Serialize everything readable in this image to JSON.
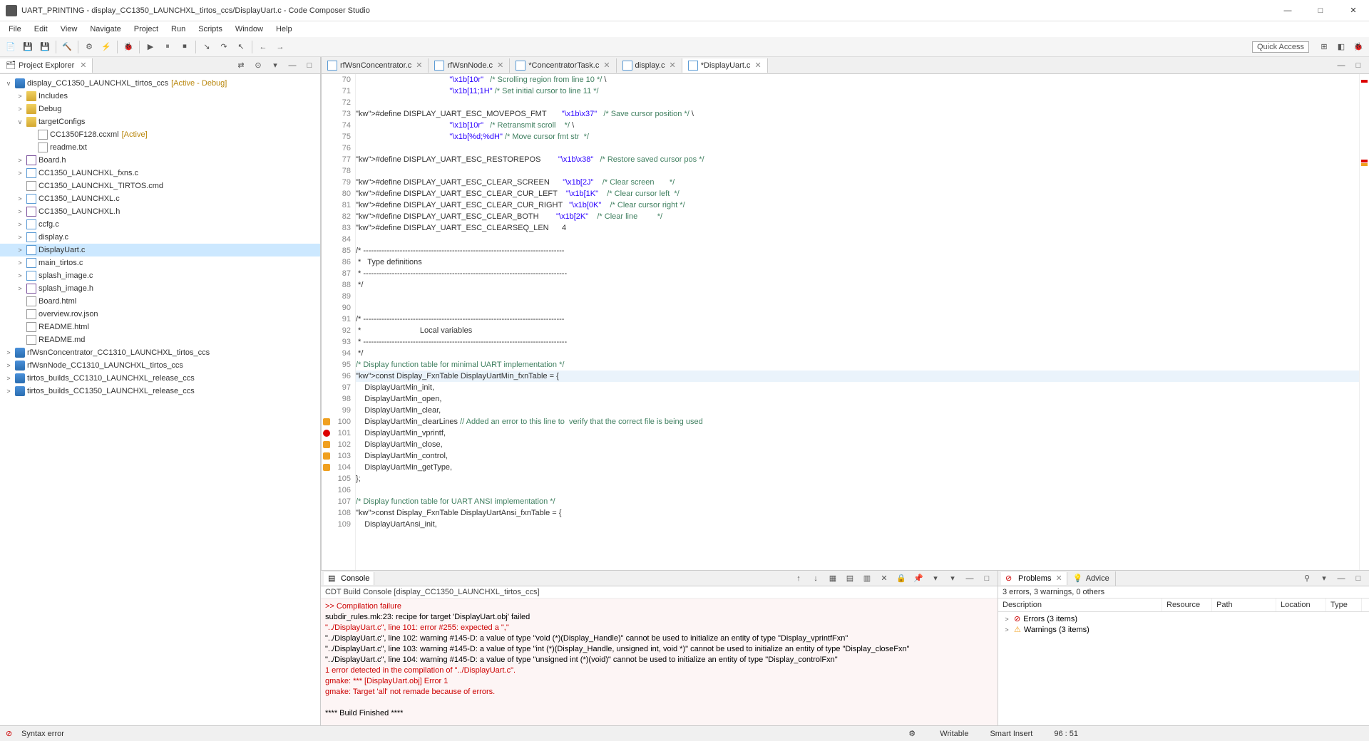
{
  "window": {
    "title": "UART_PRINTING - display_CC1350_LAUNCHXL_tirtos_ccs/DisplayUart.c - Code Composer Studio"
  },
  "menu": [
    "File",
    "Edit",
    "View",
    "Navigate",
    "Project",
    "Run",
    "Scripts",
    "Window",
    "Help"
  ],
  "quick_access": "Quick Access",
  "project_explorer": {
    "title": "Project Explorer",
    "root": {
      "label": "display_CC1350_LAUNCHXL_tirtos_ccs",
      "anno": "[Active - Debug]"
    },
    "children": [
      {
        "label": "Includes",
        "type": "folder",
        "exp": ">"
      },
      {
        "label": "Debug",
        "type": "folder",
        "exp": ">"
      },
      {
        "label": "targetConfigs",
        "type": "folder",
        "exp": "v",
        "children": [
          {
            "label": "CC1350F128.ccxml",
            "anno": "[Active]",
            "type": "file"
          },
          {
            "label": "readme.txt",
            "type": "file"
          }
        ]
      },
      {
        "label": "Board.h",
        "type": "h",
        "exp": ">"
      },
      {
        "label": "CC1350_LAUNCHXL_fxns.c",
        "type": "c",
        "exp": ">"
      },
      {
        "label": "CC1350_LAUNCHXL_TIRTOS.cmd",
        "type": "file"
      },
      {
        "label": "CC1350_LAUNCHXL.c",
        "type": "c",
        "exp": ">"
      },
      {
        "label": "CC1350_LAUNCHXL.h",
        "type": "h",
        "exp": ">"
      },
      {
        "label": "ccfg.c",
        "type": "c",
        "exp": ">"
      },
      {
        "label": "display.c",
        "type": "c",
        "exp": ">"
      },
      {
        "label": "DisplayUart.c",
        "type": "c",
        "exp": ">",
        "selected": true
      },
      {
        "label": "main_tirtos.c",
        "type": "c",
        "exp": ">"
      },
      {
        "label": "splash_image.c",
        "type": "c",
        "exp": ">"
      },
      {
        "label": "splash_image.h",
        "type": "h",
        "exp": ">"
      },
      {
        "label": "Board.html",
        "type": "file"
      },
      {
        "label": "overview.rov.json",
        "type": "file"
      },
      {
        "label": "README.html",
        "type": "file"
      },
      {
        "label": "README.md",
        "type": "file"
      }
    ],
    "siblings": [
      "rfWsnConcentrator_CC1310_LAUNCHXL_tirtos_ccs",
      "rfWsnNode_CC1310_LAUNCHXL_tirtos_ccs",
      "tirtos_builds_CC1310_LAUNCHXL_release_ccs",
      "tirtos_builds_CC1350_LAUNCHXL_release_ccs"
    ]
  },
  "editor_tabs": [
    {
      "label": "rfWsnConcentrator.c"
    },
    {
      "label": "rfWsnNode.c"
    },
    {
      "label": "*ConcentratorTask.c"
    },
    {
      "label": "display.c"
    },
    {
      "label": "*DisplayUart.c",
      "active": true
    }
  ],
  "code": [
    {
      "n": 70,
      "t": "                                           \"\\x1b[10r\"   /* Scrolling region from line 10 */ \\"
    },
    {
      "n": 71,
      "t": "                                           \"\\x1b[11;1H\" /* Set initial cursor to line 11 */"
    },
    {
      "n": 72,
      "t": ""
    },
    {
      "n": 73,
      "t": "#define DISPLAY_UART_ESC_MOVEPOS_FMT       \"\\x1b\\x37\"   /* Save cursor position */ \\"
    },
    {
      "n": 74,
      "t": "                                           \"\\x1b[10r\"   /* Retransmit scroll    */ \\"
    },
    {
      "n": 75,
      "t": "                                           \"\\x1b[%d;%dH\" /* Move cursor fmt str  */"
    },
    {
      "n": 76,
      "t": ""
    },
    {
      "n": 77,
      "t": "#define DISPLAY_UART_ESC_RESTOREPOS        \"\\x1b\\x38\"   /* Restore saved cursor pos */"
    },
    {
      "n": 78,
      "t": ""
    },
    {
      "n": 79,
      "t": "#define DISPLAY_UART_ESC_CLEAR_SCREEN      \"\\x1b[2J\"    /* Clear screen       */"
    },
    {
      "n": 80,
      "t": "#define DISPLAY_UART_ESC_CLEAR_CUR_LEFT    \"\\x1b[1K\"    /* Clear cursor left  */"
    },
    {
      "n": 81,
      "t": "#define DISPLAY_UART_ESC_CLEAR_CUR_RIGHT   \"\\x1b[0K\"    /* Clear cursor right */"
    },
    {
      "n": 82,
      "t": "#define DISPLAY_UART_ESC_CLEAR_BOTH        \"\\x1b[2K\"    /* Clear line         */"
    },
    {
      "n": 83,
      "t": "#define DISPLAY_UART_ESC_CLEARSEQ_LEN      4"
    },
    {
      "n": 84,
      "t": ""
    },
    {
      "n": 85,
      "t": "/* -----------------------------------------------------------------------------"
    },
    {
      "n": 86,
      "t": " *   Type definitions"
    },
    {
      "n": 87,
      "t": " * ------------------------------------------------------------------------------"
    },
    {
      "n": 88,
      "t": " */"
    },
    {
      "n": 89,
      "t": ""
    },
    {
      "n": 90,
      "t": ""
    },
    {
      "n": 91,
      "t": "/* -----------------------------------------------------------------------------"
    },
    {
      "n": 92,
      "t": " *                           Local variables"
    },
    {
      "n": 93,
      "t": " * ------------------------------------------------------------------------------"
    },
    {
      "n": 94,
      "t": " */"
    },
    {
      "n": 95,
      "t": "/* Display function table for minimal UART implementation */"
    },
    {
      "n": 96,
      "t": "const Display_FxnTable DisplayUartMin_fxnTable = {",
      "hl": true
    },
    {
      "n": 97,
      "t": "    DisplayUartMin_init,"
    },
    {
      "n": 98,
      "t": "    DisplayUartMin_open,"
    },
    {
      "n": 99,
      "t": "    DisplayUartMin_clear,"
    },
    {
      "n": 100,
      "t": "    DisplayUartMin_clearLines // Added an error to this line to  verify that the correct file is being used",
      "mark": "warn"
    },
    {
      "n": 101,
      "t": "    DisplayUartMin_vprintf,",
      "mark": "err"
    },
    {
      "n": 102,
      "t": "    DisplayUartMin_close,",
      "mark": "warn"
    },
    {
      "n": 103,
      "t": "    DisplayUartMin_control,",
      "mark": "warn"
    },
    {
      "n": 104,
      "t": "    DisplayUartMin_getType,",
      "mark": "warn"
    },
    {
      "n": 105,
      "t": "};"
    },
    {
      "n": 106,
      "t": ""
    },
    {
      "n": 107,
      "t": "/* Display function table for UART ANSI implementation */"
    },
    {
      "n": 108,
      "t": "const Display_FxnTable DisplayUartAnsi_fxnTable = {"
    },
    {
      "n": 109,
      "t": "    DisplayUartAnsi_init,"
    }
  ],
  "console": {
    "title": "Console",
    "subtitle": "CDT Build Console [display_CC1350_LAUNCHXL_tirtos_ccs]",
    "lines": [
      ">> Compilation failure",
      "subdir_rules.mk:23: recipe for target 'DisplayUart.obj' failed",
      "\"../DisplayUart.c\", line 101: error #255: expected a \",\"",
      "\"../DisplayUart.c\", line 102: warning #145-D: a value of type \"void (*)(Display_Handle)\" cannot be used to initialize an entity of type \"Display_vprintfFxn\"",
      "\"../DisplayUart.c\", line 103: warning #145-D: a value of type \"int (*)(Display_Handle, unsigned int, void *)\" cannot be used to initialize an entity of type \"Display_closeFxn\"",
      "\"../DisplayUart.c\", line 104: warning #145-D: a value of type \"unsigned int (*)(void)\" cannot be used to initialize an entity of type \"Display_controlFxn\"",
      "1 error detected in the compilation of \"../DisplayUart.c\".",
      "gmake: *** [DisplayUart.obj] Error 1",
      "gmake: Target 'all' not remade because of errors.",
      "",
      "**** Build Finished ****"
    ]
  },
  "problems": {
    "title": "Problems",
    "advice": "Advice",
    "summary": "3 errors, 3 warnings, 0 others",
    "cols": [
      "Description",
      "Resource",
      "Path",
      "Location",
      "Type"
    ],
    "rows": [
      {
        "icon": "err",
        "label": "Errors (3 items)"
      },
      {
        "icon": "warn",
        "label": "Warnings (3 items)"
      }
    ]
  },
  "status": {
    "left": "Syntax error",
    "writable": "Writable",
    "insert": "Smart Insert",
    "pos": "96 : 51"
  }
}
